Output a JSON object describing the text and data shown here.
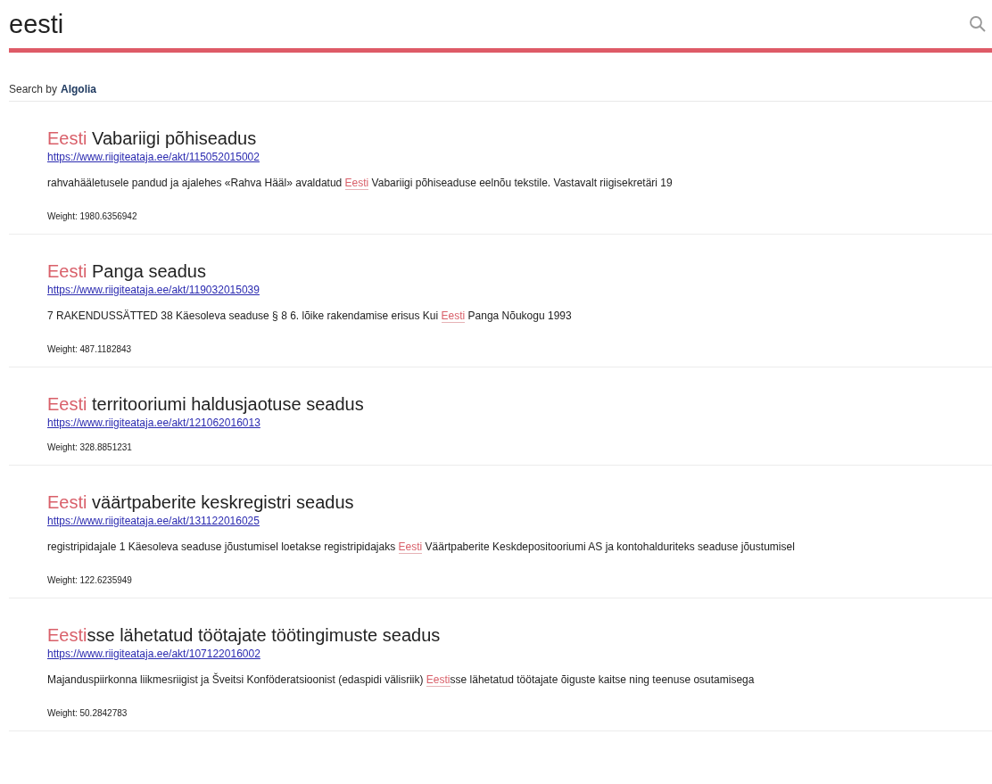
{
  "search": {
    "value": "eesti"
  },
  "attribution": {
    "label": "Search by",
    "brand": "Algolia"
  },
  "results": [
    {
      "title": [
        {
          "text": "Eesti",
          "highlight": true
        },
        {
          "text": " Vabariigi põhiseadus",
          "highlight": false
        }
      ],
      "url": "https://www.riigiteataja.ee/akt/115052015002",
      "snippet": [
        {
          "text": "rahvahääletusele pandud ja ajalehes «Rahva Hääl» avaldatud ",
          "highlight": false
        },
        {
          "text": "Eesti",
          "highlight": true
        },
        {
          "text": " Vabariigi põhiseaduse eelnõu tekstile. Vastavalt riigisekretäri 19",
          "highlight": false
        }
      ],
      "weight": "Weight: 1980.6356942"
    },
    {
      "title": [
        {
          "text": "Eesti",
          "highlight": true
        },
        {
          "text": " Panga seadus",
          "highlight": false
        }
      ],
      "url": "https://www.riigiteataja.ee/akt/119032015039",
      "snippet": [
        {
          "text": "7 RAKENDUSSÄTTED 38 Käesoleva seaduse § 8 6. lõike rakendamise erisus Kui ",
          "highlight": false
        },
        {
          "text": "Eesti",
          "highlight": true
        },
        {
          "text": " Panga Nõukogu 1993",
          "highlight": false
        }
      ],
      "weight": "Weight: 487.1182843"
    },
    {
      "title": [
        {
          "text": "Eesti",
          "highlight": true
        },
        {
          "text": " territooriumi haldusjaotuse seadus",
          "highlight": false
        }
      ],
      "url": "https://www.riigiteataja.ee/akt/121062016013",
      "weight": "Weight: 328.8851231"
    },
    {
      "title": [
        {
          "text": "Eesti",
          "highlight": true
        },
        {
          "text": " väärtpaberite keskregistri seadus",
          "highlight": false
        }
      ],
      "url": "https://www.riigiteataja.ee/akt/131122016025",
      "snippet": [
        {
          "text": "registripidajale 1 Käesoleva seaduse jõustumisel loetakse registripidajaks ",
          "highlight": false
        },
        {
          "text": "Eesti",
          "highlight": true
        },
        {
          "text": " Väärtpaberite Keskdepositooriumi AS ja kontohalduriteks seaduse jõustumisel",
          "highlight": false
        }
      ],
      "weight": "Weight: 122.6235949"
    },
    {
      "title": [
        {
          "text": "Eesti",
          "highlight": true
        },
        {
          "text": "sse lähetatud töötajate töötingimuste seadus",
          "highlight": false
        }
      ],
      "url": "https://www.riigiteataja.ee/akt/107122016002",
      "snippet": [
        {
          "text": "Majanduspiirkonna liikmesriigist ja Šveitsi Konföderatsioonist (edaspidi välisriik) ",
          "highlight": false
        },
        {
          "text": "Eesti",
          "highlight": true
        },
        {
          "text": "sse lähetatud töötajate õiguste kaitse ning teenuse osutamisega",
          "highlight": false
        }
      ],
      "weight": "Weight: 50.2842783"
    }
  ]
}
